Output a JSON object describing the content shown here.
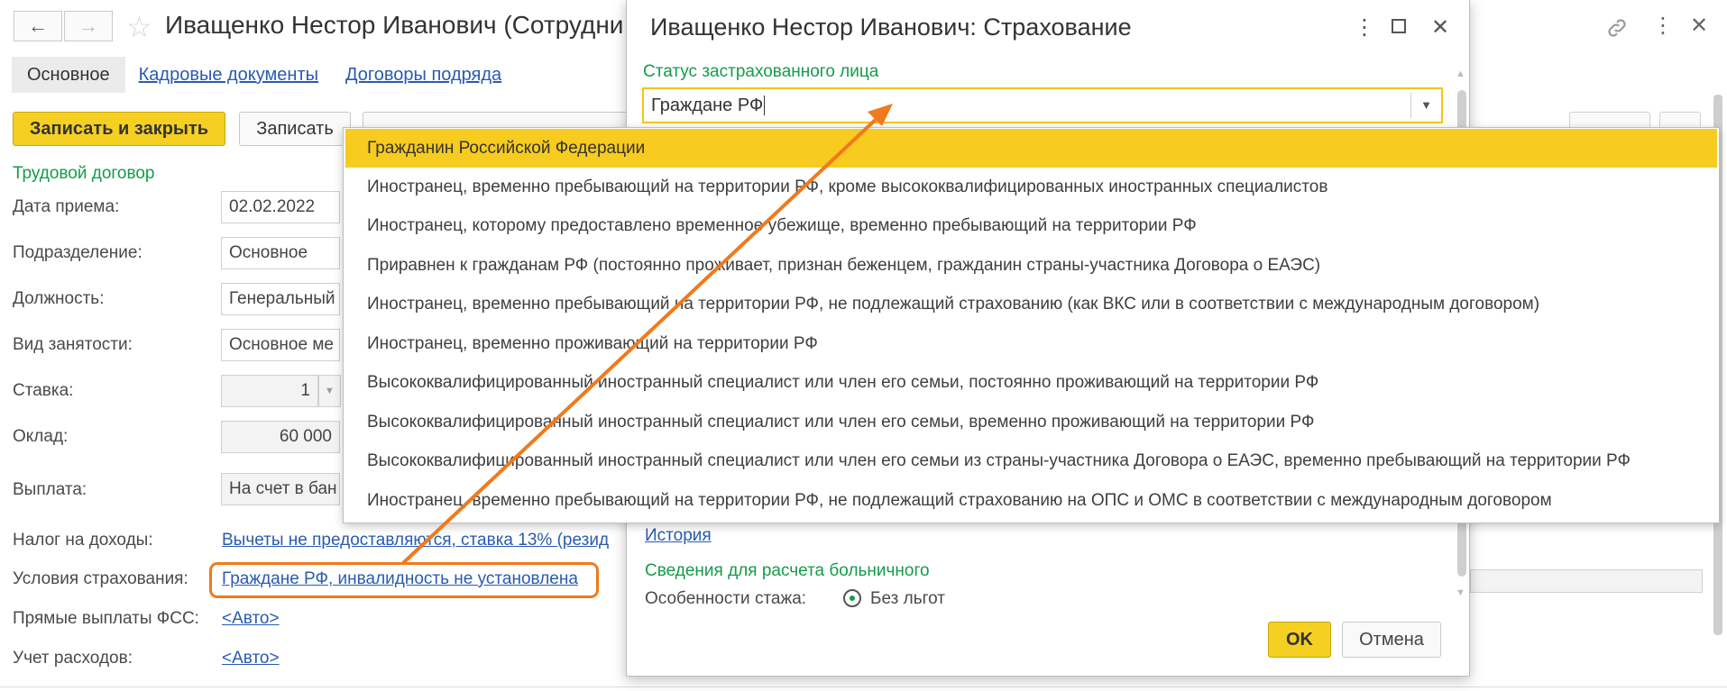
{
  "form": {
    "title": "Иващенко Нестор Иванович (Сотрудни",
    "tabs": [
      "Основное",
      "Кадровые документы",
      "Договоры подряда"
    ],
    "save_close_label": "Записать и закрыть",
    "save_label": "Записать",
    "section_title": "Трудовой договор",
    "fields": {
      "hire_date": {
        "label": "Дата приема:",
        "value": "02.02.2022"
      },
      "department": {
        "label": "Подразделение:",
        "value": "Основное"
      },
      "position": {
        "label": "Должность:",
        "value": "Генеральный"
      },
      "employment_type": {
        "label": "Вид занятости:",
        "value": "Основное ме"
      },
      "rate": {
        "label": "Ставка:",
        "value": "1"
      },
      "salary": {
        "label": "Оклад:",
        "value": "60 000"
      },
      "payment": {
        "label": "Выплата:",
        "value": "На счет в бан"
      },
      "income_tax": {
        "label": "Налог на доходы:",
        "value": "Вычеты не предоставляются, ставка 13% (резид"
      },
      "insurance": {
        "label": "Условия страхования:",
        "value": "Граждане РФ, инвалидность не установлена"
      },
      "fss": {
        "label": "Прямые выплаты ФСС:",
        "value": "<Авто>"
      },
      "expenses": {
        "label": "Учет расходов:",
        "value": "<Авто>"
      }
    }
  },
  "modal": {
    "title": "Иващенко Нестор Иванович: Страхование",
    "status_label": "Статус застрахованного лица",
    "status_input_value": "Граждане РФ",
    "history_link": "История",
    "sick_leave_section": "Сведения для расчета больничного",
    "seniority_label": "Особенности стажа:",
    "seniority_option": "Без льгот",
    "ok_label": "OK",
    "cancel_label": "Отмена"
  },
  "dropdown": {
    "items": [
      "Гражданин Российской Федерации",
      "Иностранец, временно пребывающий на территории РФ, кроме высококвалифицированных иностранных специалистов",
      "Иностранец, которому предоставлено временное убежище, временно пребывающий на территории РФ",
      "Приравнен к гражданам РФ (постоянно проживает, признан беженцем, гражданин страны-участника Договора о ЕАЭС)",
      "Иностранец, временно пребывающий на территории РФ, не подлежащий страхованию (как ВКС или в соответствии с международным договором)",
      "Иностранец, временно проживающий на территории РФ",
      "Высококвалифицированный иностранный специалист или член его семьи, постоянно проживающий на территории РФ",
      "Высококвалифицированный иностранный специалист или член его семьи, временно проживающий на территории РФ",
      "Высококвалифицированный иностранный специалист или член его семьи из страны-участника Договора о ЕАЭС, временно пребывающий на территории РФ",
      "Иностранец, временно пребывающий на территории РФ, не подлежащий страхованию на ОПС и ОМС в соответствии с международным договором"
    ]
  },
  "colors": {
    "accent_yellow": "#f5d022",
    "section_green": "#159b4a",
    "link_blue": "#2a5bb0",
    "annotation_orange": "#f07a1c"
  },
  "icons": {
    "back": "arrow-left-icon",
    "forward": "arrow-right-icon",
    "favorite": "star-icon",
    "link": "link-icon",
    "more": "more-vertical-icon",
    "maximize": "maximize-icon",
    "close": "close-icon",
    "dropdown": "chevron-down-icon"
  }
}
